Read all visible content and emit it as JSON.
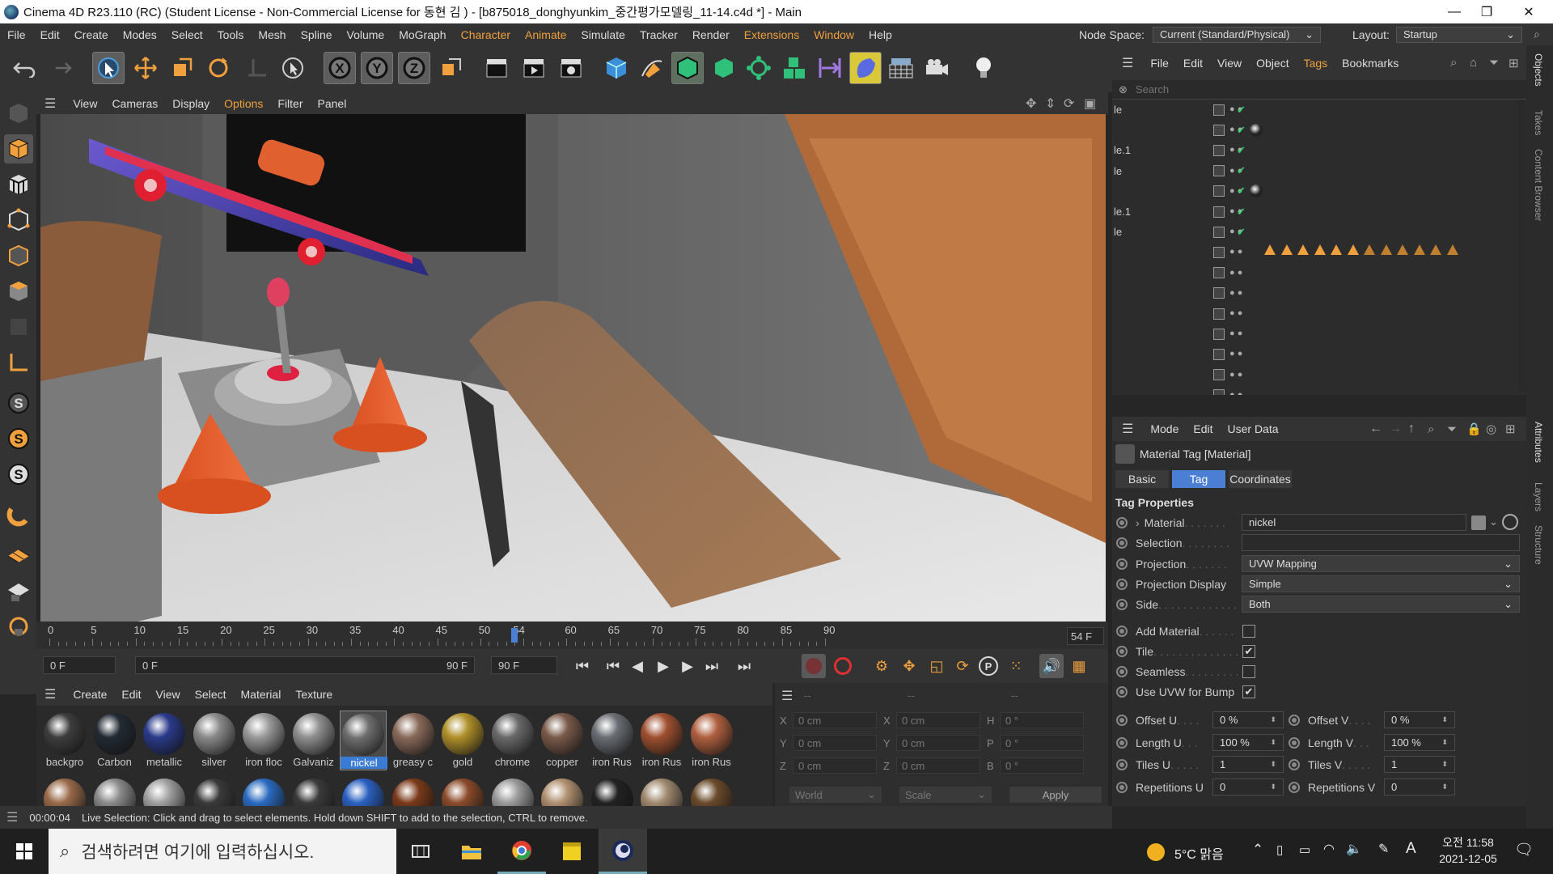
{
  "window": {
    "title": "Cinema 4D R23.110 (RC) (Student License - Non-Commercial License for 동현 김 ) - [b875018_donghyunkim_중간평가모델링_11-14.c4d *] - Main"
  },
  "menubar": {
    "items": [
      "File",
      "Edit",
      "Create",
      "Modes",
      "Select",
      "Tools",
      "Mesh",
      "Spline",
      "Volume",
      "MoGraph",
      "Character",
      "Animate",
      "Simulate",
      "Tracker",
      "Render",
      "Extensions",
      "Window",
      "Help"
    ],
    "node_space_label": "Node Space:",
    "node_space_value": "Current (Standard/Physical)",
    "layout_label": "Layout:",
    "layout_value": "Startup"
  },
  "viewport": {
    "menu": [
      "View",
      "Cameras",
      "Display",
      "Options",
      "Filter",
      "Panel"
    ]
  },
  "timeline": {
    "ticks": [
      "0",
      "5",
      "10",
      "15",
      "20",
      "25",
      "30",
      "35",
      "40",
      "45",
      "50",
      "54",
      "60",
      "65",
      "70",
      "75",
      "80",
      "85",
      "90"
    ],
    "current_frame": "54 F",
    "start_field": "0 F",
    "range_start": "0 F",
    "range_end": "90 F",
    "end_field": "90 F",
    "current": 54,
    "max": 90
  },
  "material_manager": {
    "menu": [
      "Create",
      "Edit",
      "View",
      "Select",
      "Material",
      "Texture"
    ],
    "materials": [
      {
        "name": "backgro",
        "color": "#3d3d3d"
      },
      {
        "name": "Carbon",
        "color": "#222a33"
      },
      {
        "name": "metallic",
        "color": "#2a3a8a"
      },
      {
        "name": "silver",
        "color": "#8a8a8a"
      },
      {
        "name": "iron floc",
        "color": "#9a9a9a"
      },
      {
        "name": "Galvaniz",
        "color": "#8f8f8f"
      },
      {
        "name": "nickel",
        "color": "#6e6e6e"
      },
      {
        "name": "greasy c",
        "color": "#8a6a5a"
      },
      {
        "name": "gold",
        "color": "#b0902a"
      },
      {
        "name": "chrome",
        "color": "#6a6a6a"
      },
      {
        "name": "copper",
        "color": "#7a5a4a"
      },
      {
        "name": "iron Rus",
        "color": "#6a6e74"
      },
      {
        "name": "iron Rus",
        "color": "#a05030"
      },
      {
        "name": "iron Rus",
        "color": "#b06040"
      }
    ],
    "second_row_colors": [
      "#9a6a4a",
      "#8a8a8a",
      "#a0a0a0",
      "#3a3a3a",
      "#2a6ac0",
      "#3a3a3a",
      "#2a60c0",
      "#7a3a1a",
      "#8a4a2a",
      "#9a9a9a",
      "#b09070",
      "#222222",
      "#a08a70",
      "#6a4a2a"
    ]
  },
  "coordinates": {
    "head": [
      "--",
      "--",
      "--"
    ],
    "rows": [
      {
        "a": "X",
        "av": "0 cm",
        "b": "X",
        "bv": "0 cm",
        "c": "H",
        "cv": "0 °"
      },
      {
        "a": "Y",
        "av": "0 cm",
        "b": "Y",
        "bv": "0 cm",
        "c": "P",
        "cv": "0 °"
      },
      {
        "a": "Z",
        "av": "0 cm",
        "b": "Z",
        "bv": "0 cm",
        "c": "B",
        "cv": "0 °"
      }
    ],
    "space": "World",
    "mode": "Scale",
    "apply": "Apply"
  },
  "status": {
    "time": "00:00:04",
    "message": "Live Selection: Click and drag to select elements. Hold down SHIFT to add to the selection, CTRL to remove."
  },
  "object_manager": {
    "menu": [
      "File",
      "Edit",
      "View",
      "Object",
      "Tags",
      "Bookmarks"
    ],
    "search_placeholder": "Search",
    "rows": [
      "le",
      "",
      "le.1",
      "le",
      "",
      "le.1",
      "le",
      "",
      "",
      "",
      "",
      "",
      "",
      "",
      ""
    ]
  },
  "attribute_manager": {
    "menu": [
      "Mode",
      "Edit",
      "User Data"
    ],
    "title": "Material Tag [Material]",
    "tabs": [
      "Basic",
      "Tag",
      "Coordinates"
    ],
    "section": "Tag Properties",
    "material_label": "Material",
    "material_value": "nickel",
    "selection_label": "Selection",
    "projection_label": "Projection",
    "projection_value": "UVW Mapping",
    "projection_display_label": "Projection Display",
    "projection_display_value": "Simple",
    "side_label": "Side",
    "side_value": "Both",
    "add_material_label": "Add Material",
    "tile_label": "Tile",
    "seamless_label": "Seamless",
    "uvw_bump_label": "Use UVW for Bump",
    "offset_u_label": "Offset U",
    "offset_u": "0 %",
    "offset_v_label": "Offset V",
    "offset_v": "0 %",
    "length_u_label": "Length U",
    "length_u": "100 %",
    "length_v_label": "Length V",
    "length_v": "100 %",
    "tiles_u_label": "Tiles U",
    "tiles_u": "1",
    "tiles_v_label": "Tiles V",
    "tiles_v": "1",
    "rep_u_label": "Repetitions U",
    "rep_u": "0",
    "rep_v_label": "Repetitions V",
    "rep_v": "0"
  },
  "side_tabs": [
    "Objects",
    "Takes",
    "Content Browser",
    "Attributes",
    "Layers",
    "Structure"
  ],
  "taskbar": {
    "search_placeholder": "검색하려면 여기에 입력하십시오.",
    "weather": "5°C 맑음",
    "ime": "A",
    "time": "오전 11:58",
    "date": "2021-12-05"
  }
}
